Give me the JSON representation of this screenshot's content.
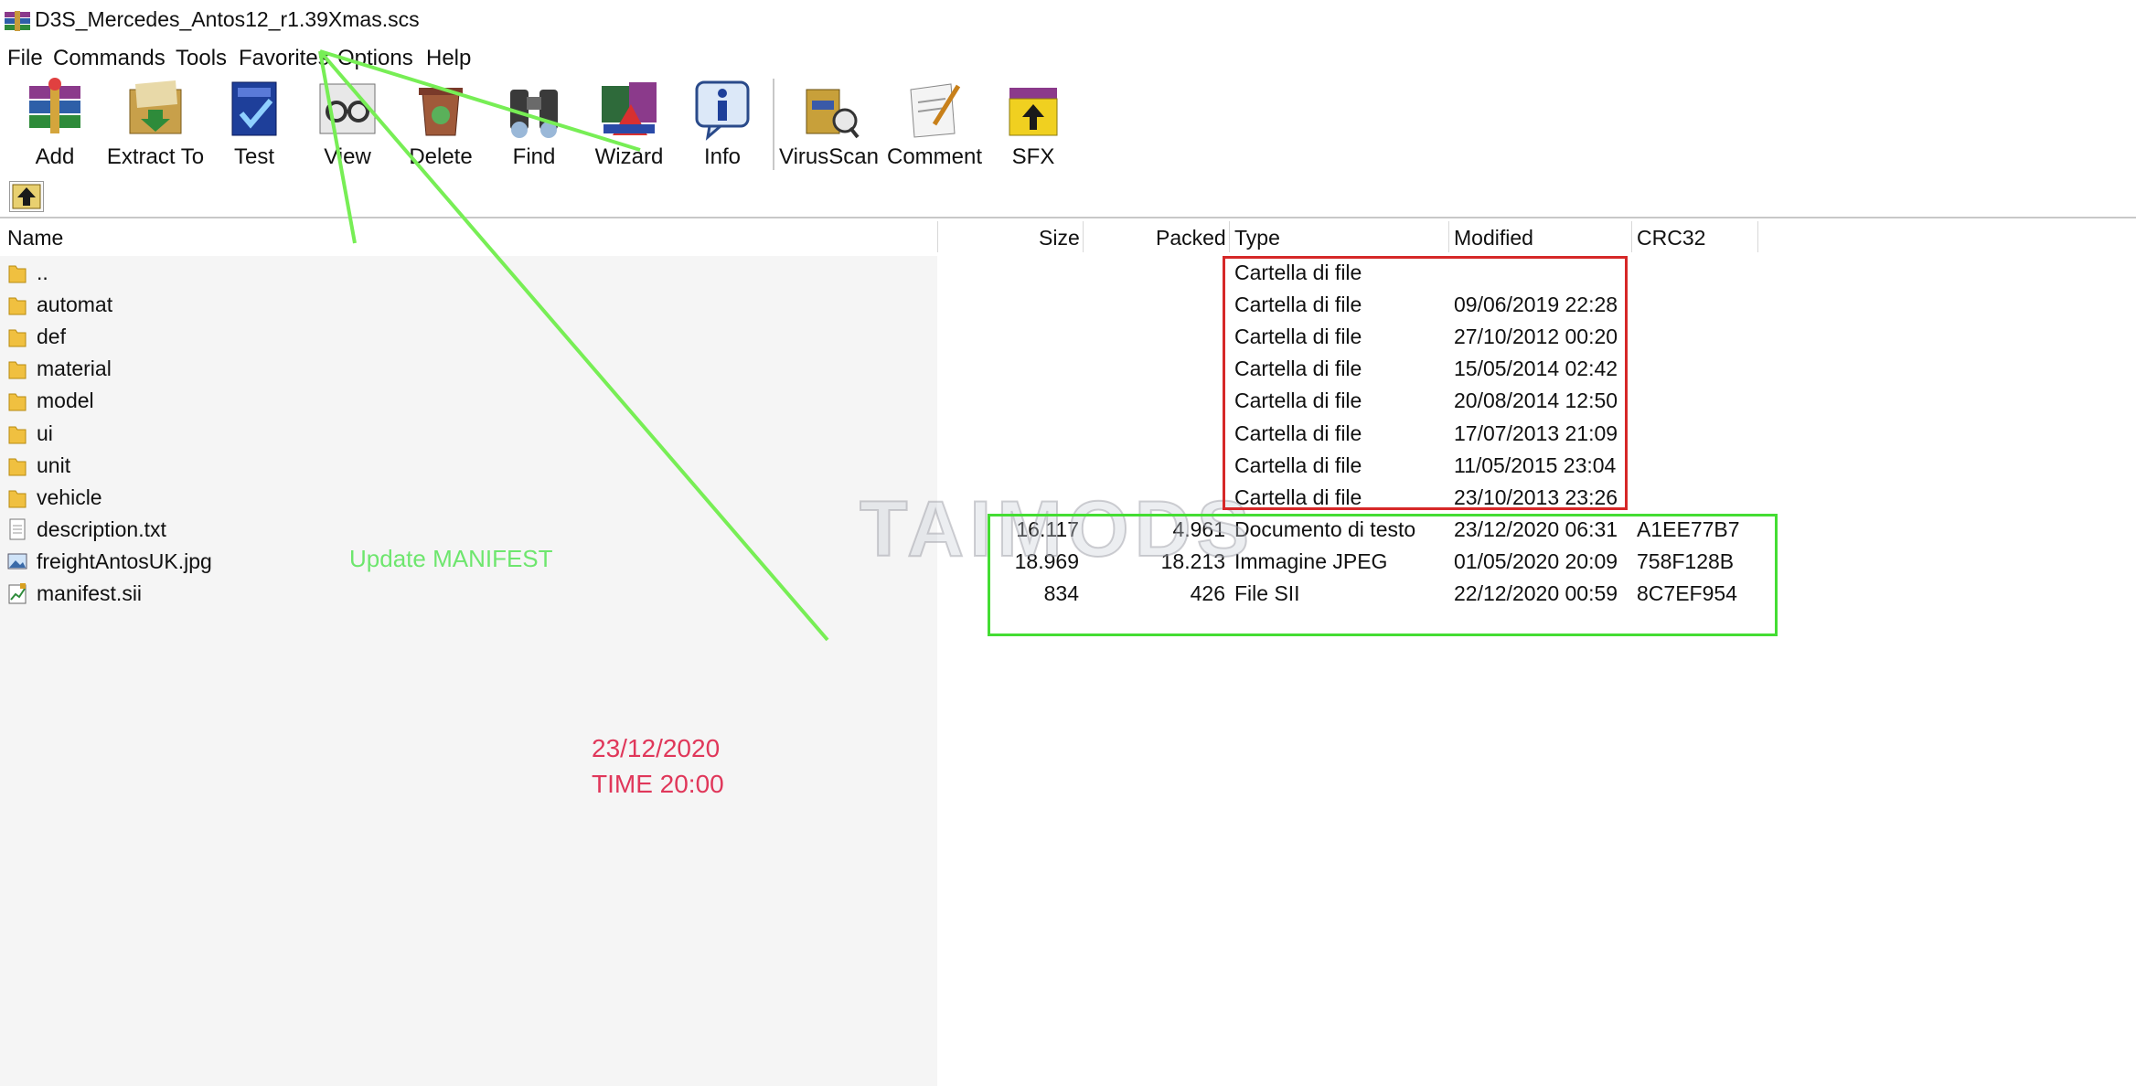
{
  "window": {
    "title": "D3S_Mercedes_Antos12_r1.39Xmas.scs"
  },
  "menu": [
    "File",
    "Commands",
    "Tools",
    "Favorites",
    "Options",
    "Help"
  ],
  "toolbar": [
    {
      "label": "Add",
      "icon": "add-archive-icon"
    },
    {
      "label": "Extract To",
      "icon": "extract-to-icon"
    },
    {
      "label": "Test",
      "icon": "test-icon"
    },
    {
      "label": "View",
      "icon": "view-icon"
    },
    {
      "label": "Delete",
      "icon": "delete-icon"
    },
    {
      "label": "Find",
      "icon": "find-binoculars-icon"
    },
    {
      "label": "Wizard",
      "icon": "wizard-icon"
    },
    {
      "label": "Info",
      "icon": "info-icon"
    },
    {
      "label": "VirusScan",
      "icon": "virusscan-icon"
    },
    {
      "label": "Comment",
      "icon": "comment-icon"
    },
    {
      "label": "SFX",
      "icon": "sfx-icon"
    }
  ],
  "columns": {
    "name": "Name",
    "size": "Size",
    "packed": "Packed",
    "type": "Type",
    "modified": "Modified",
    "crc": "CRC32"
  },
  "rows": [
    {
      "name": "..",
      "size": "",
      "packed": "",
      "type": "Cartella di file",
      "modified": "",
      "crc": "",
      "icon": "folder-icon"
    },
    {
      "name": "automat",
      "size": "",
      "packed": "",
      "type": "Cartella di file",
      "modified": "09/06/2019 22:28",
      "crc": "",
      "icon": "folder-icon"
    },
    {
      "name": "def",
      "size": "",
      "packed": "",
      "type": "Cartella di file",
      "modified": "27/10/2012 00:20",
      "crc": "",
      "icon": "folder-icon"
    },
    {
      "name": "material",
      "size": "",
      "packed": "",
      "type": "Cartella di file",
      "modified": "15/05/2014 02:42",
      "crc": "",
      "icon": "folder-icon"
    },
    {
      "name": "model",
      "size": "",
      "packed": "",
      "type": "Cartella di file",
      "modified": "20/08/2014 12:50",
      "crc": "",
      "icon": "folder-icon"
    },
    {
      "name": "ui",
      "size": "",
      "packed": "",
      "type": "Cartella di file",
      "modified": "17/07/2013 21:09",
      "crc": "",
      "icon": "folder-icon"
    },
    {
      "name": "unit",
      "size": "",
      "packed": "",
      "type": "Cartella di file",
      "modified": "11/05/2015 23:04",
      "crc": "",
      "icon": "folder-icon"
    },
    {
      "name": "vehicle",
      "size": "",
      "packed": "",
      "type": "Cartella di file",
      "modified": "23/10/2013 23:26",
      "crc": "",
      "icon": "folder-icon"
    },
    {
      "name": "description.txt",
      "size": "16.117",
      "packed": "4.961",
      "type": "Documento di testo",
      "modified": "23/12/2020 06:31",
      "crc": "A1EE77B7",
      "icon": "text-file-icon"
    },
    {
      "name": "freightAntosUK.jpg",
      "size": "18.969",
      "packed": "18.213",
      "type": "Immagine JPEG",
      "modified": "01/05/2020 20:09",
      "crc": "758F128B",
      "icon": "image-file-icon"
    },
    {
      "name": "manifest.sii",
      "size": "834",
      "packed": "426",
      "type": "File SII",
      "modified": "22/12/2020 00:59",
      "crc": "8C7EF954",
      "icon": "sii-file-icon"
    }
  ],
  "annotations": {
    "note": "Update MANIFEST",
    "date": "23/12/2020",
    "time": "TIME 20:00",
    "watermark": "TAIMODS",
    "colors": {
      "green": "#6ee66e",
      "red": "#e0375a",
      "box_red": "#d62828",
      "box_green": "#44dd33"
    }
  }
}
